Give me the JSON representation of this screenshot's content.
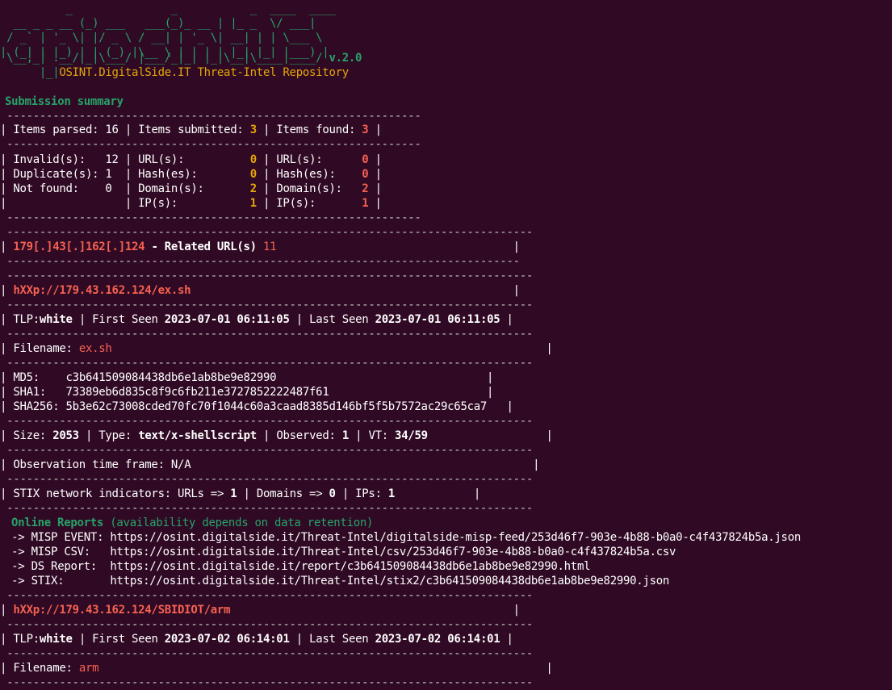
{
  "logo": {
    "art": [
      "          _               _           _  ____  ____",
      "  __ _ _ __ (_) ___   ___(_)_ __ | |_ _  \\/ ___|",
      " / _` | '_ \\| |/ _ \\ / __| | '_ \\| __| | | \\___ \\",
      "| (_| | |_) | | (_) |\\__ \\ | | | | |_| |_| |___) |",
      " \\__,_| .__/|_|\\___/ |___/_|_| |_|\\__|\\____|____/",
      "      |_|"
    ],
    "version": "v.2.0",
    "tagline": "OSINT.DigitalSide.IT Threat-Intel Repository"
  },
  "summary": {
    "title": "Submission summary",
    "items_parsed_label": "Items parsed:",
    "items_parsed": "16",
    "items_submitted_label": "Items submitted:",
    "items_submitted": "3",
    "items_found_label": "Items found:",
    "items_found": "3",
    "left": [
      {
        "label": "Invalid(s):",
        "value": "12"
      },
      {
        "label": "Duplicate(s):",
        "value": "1"
      },
      {
        "label": "Not found:",
        "value": "0"
      }
    ],
    "submitted": [
      {
        "label": "URL(s):",
        "value": "0"
      },
      {
        "label": "Hash(es):",
        "value": "0"
      },
      {
        "label": "Domain(s):",
        "value": "2"
      },
      {
        "label": "IP(s):",
        "value": "1"
      }
    ],
    "found": [
      {
        "label": "URL(s):",
        "value": "0"
      },
      {
        "label": "Hash(es):",
        "value": "0"
      },
      {
        "label": "Domain(s):",
        "value": "2"
      },
      {
        "label": "IP(s):",
        "value": "1"
      }
    ]
  },
  "ip_block": {
    "ip": "179[.]43[.]162[.]124",
    "related_label": " - Related URL(s) ",
    "related_count": "11"
  },
  "entries": [
    {
      "url": "hXXp://179.43.162.124/ex.sh",
      "tlp_label": "TLP:",
      "tlp": "white",
      "first_seen_label": "First Seen",
      "first_seen": "2023-07-01 06:11:05",
      "last_seen_label": "Last Seen",
      "last_seen": "2023-07-01 06:11:05",
      "filename_label": "Filename:",
      "filename": "ex.sh",
      "md5_label": "MD5:",
      "md5": "c3b641509084438db6e1ab8be9e82990",
      "sha1_label": "SHA1:",
      "sha1": "73389eb6d835c8f9c6fb211e3727852222487f61",
      "sha256_label": "SHA256:",
      "sha256": "5b3e62c73008cded70fc70f1044c60a3caad8385d146bf5f5b7572ac29c65ca7",
      "size_label": "Size:",
      "size": "2053",
      "type_label": "Type:",
      "type": "text/x-shellscript",
      "observed_label": "Observed:",
      "observed": "1",
      "vt_label": "VT:",
      "vt": "34/59",
      "timeframe_label": "Observation time frame:",
      "timeframe": "N/A",
      "stix_label": "STIX network indicators:",
      "stix_urls_label": "URLs =>",
      "stix_urls": "1",
      "stix_domains_label": "Domains =>",
      "stix_domains": "0",
      "stix_ips_label": "IPs:",
      "stix_ips": "1",
      "reports_title": "Online Reports",
      "reports_note": "(availability depends on data retention)",
      "reports": [
        {
          "label": " -> MISP EVENT: ",
          "url": "https://osint.digitalside.it/Threat-Intel/digitalside-misp-feed/253d46f7-903e-4b88-b0a0-c4f437824b5a.json"
        },
        {
          "label": " -> MISP CSV:   ",
          "url": "https://osint.digitalside.it/Threat-Intel/csv/253d46f7-903e-4b88-b0a0-c4f437824b5a.csv"
        },
        {
          "label": " -> DS Report:  ",
          "url": "https://osint.digitalside.it/report/c3b641509084438db6e1ab8be9e82990.html"
        },
        {
          "label": " -> STIX:       ",
          "url": "https://osint.digitalside.it/Threat-Intel/stix2/c3b641509084438db6e1ab8be9e82990.json"
        }
      ]
    },
    {
      "url": "hXXp://179.43.162.124/SBIDIOT/arm",
      "tlp_label": "TLP:",
      "tlp": "white",
      "first_seen_label": "First Seen",
      "first_seen": "2023-07-02 06:14:01",
      "last_seen_label": "Last Seen",
      "last_seen": "2023-07-02 06:14:01",
      "filename_label": "Filename:",
      "filename": "arm"
    }
  ],
  "colors": {
    "background": "#300a24",
    "text": "#ffffff",
    "green": "#26a269",
    "yellow": "#e5a50a",
    "red": "#f66151"
  }
}
